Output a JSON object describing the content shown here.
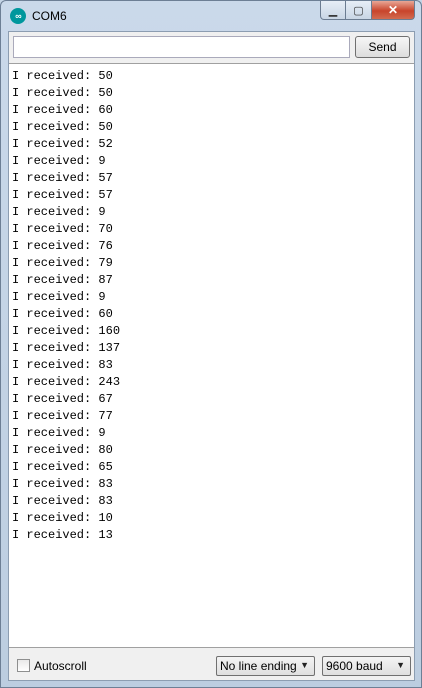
{
  "window": {
    "title": "COM6",
    "app_icon_glyph": "∞",
    "minimize_glyph": "▁",
    "maximize_glyph": "▢",
    "close_glyph": "✕"
  },
  "send": {
    "input_value": "",
    "input_placeholder": "",
    "button_label": "Send"
  },
  "output": {
    "lines": [
      "I received: 50",
      "I received: 50",
      "I received: 60",
      "I received: 50",
      "I received: 52",
      "I received: 9",
      "I received: 57",
      "I received: 57",
      "I received: 9",
      "I received: 70",
      "I received: 76",
      "I received: 79",
      "I received: 87",
      "I received: 9",
      "I received: 60",
      "I received: 160",
      "I received: 137",
      "I received: 83",
      "I received: 243",
      "I received: 67",
      "I received: 77",
      "I received: 9",
      "I received: 80",
      "I received: 65",
      "I received: 83",
      "I received: 83",
      "I received: 10",
      "I received: 13"
    ]
  },
  "footer": {
    "autoscroll_label": "Autoscroll",
    "line_ending": "No line ending",
    "baud": "9600 baud",
    "dropdown_glyph": "▼"
  },
  "icons": {
    "app": "arduino-icon",
    "minimize": "minimize-icon",
    "maximize": "maximize-icon",
    "close": "close-icon",
    "dropdown": "chevron-down-icon"
  },
  "colors": {
    "accent": "#00979d",
    "close_button": "#c8442b"
  }
}
